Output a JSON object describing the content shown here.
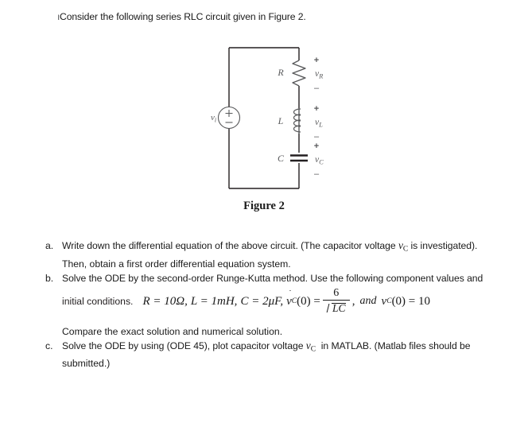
{
  "document": {
    "intro": "Consider the following series RLC circuit given in Figure 2.",
    "stray_mark": "ı",
    "figure_caption": "Figure 2"
  },
  "circuit": {
    "type": "series RLC circuit",
    "source_label": "v",
    "source_sub": "i",
    "source_plus": "+",
    "source_minus": "−",
    "components": [
      {
        "name": "resistor",
        "label": "R",
        "voltage_label": "v",
        "voltage_sub": "R",
        "polarity_plus": "+",
        "polarity_minus": "–"
      },
      {
        "name": "inductor",
        "label": "L",
        "voltage_label": "v",
        "voltage_sub": "L",
        "polarity_plus": "+",
        "polarity_minus": "–"
      },
      {
        "name": "capacitor",
        "label": "C",
        "voltage_label": "v",
        "voltage_sub": "C",
        "polarity_plus": "+",
        "polarity_minus": "–"
      }
    ],
    "wire_color": "#231f20",
    "label_color": "#58595b"
  },
  "questions": [
    {
      "marker": "a.",
      "line1_pre": "Write down the differential equation of the above circuit. (The capacitor voltage ",
      "var_v": "v",
      "var_sub": "C",
      "line1_post": " is investigated).",
      "line2": "Then, obtain a first order differential equation system."
    },
    {
      "marker": "b.",
      "line1": "Solve the ODE by the second-order Runge-Kutta method. Use the following component values and",
      "eq_lead": "initial conditions.",
      "equation": {
        "R": "R = 10Ω,",
        "L": "L = 1mH,",
        "C": "C = 2μF,",
        "vdot": "v",
        "vdot_sub": "C",
        "vdot_rest": "(0) =",
        "numerator": "6",
        "denominator": "LC",
        "comma": ",",
        "and": "and",
        "vc": "v",
        "vc_sub": "C",
        "vc_rest": "(0) = 10"
      },
      "line3": "Compare the exact solution and numerical solution."
    },
    {
      "marker": "c.",
      "line1_pre": "Solve the ODE by using (ODE 45), plot capacitor voltage",
      "var_v": "v",
      "var_sub": "C",
      "line1_post": "in MATLAB.   (Matlab files should be",
      "line2": "submitted.)"
    }
  ]
}
